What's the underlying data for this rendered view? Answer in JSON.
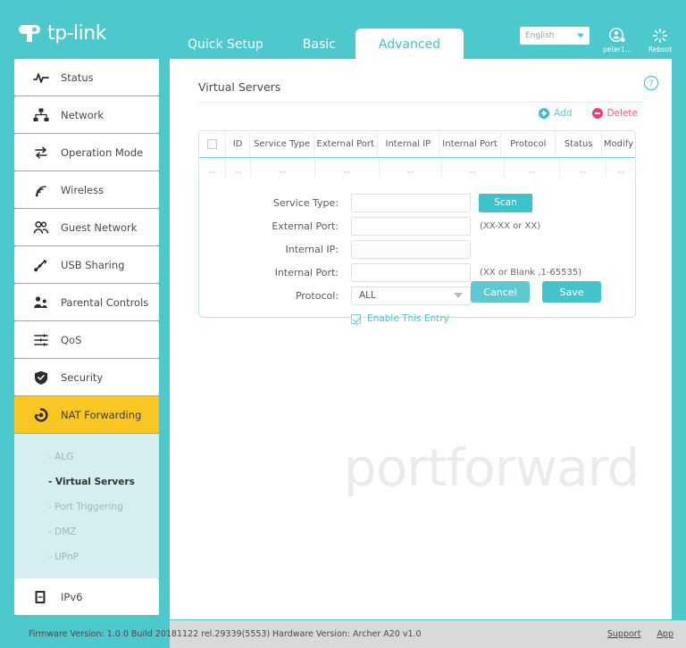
{
  "header": {
    "brand": "tp-link",
    "tabs": [
      {
        "label": "Quick Setup",
        "active": false
      },
      {
        "label": "Basic",
        "active": false
      },
      {
        "label": "Advanced",
        "active": true
      }
    ],
    "language": "English",
    "user_label": "peter1...",
    "reboot_label": "Reboot"
  },
  "sidebar": {
    "items": [
      {
        "label": "Status",
        "icon": "pulse-icon"
      },
      {
        "label": "Network",
        "icon": "network-icon"
      },
      {
        "label": "Operation Mode",
        "icon": "swap-icon"
      },
      {
        "label": "Wireless",
        "icon": "wifi-icon"
      },
      {
        "label": "Guest Network",
        "icon": "guest-icon"
      },
      {
        "label": "USB Sharing",
        "icon": "usb-icon"
      },
      {
        "label": "Parental Controls",
        "icon": "parental-icon"
      },
      {
        "label": "QoS",
        "icon": "qos-icon"
      },
      {
        "label": "Security",
        "icon": "shield-icon"
      },
      {
        "label": "NAT Forwarding",
        "icon": "nat-icon",
        "active": true
      },
      {
        "label": "IPv6",
        "icon": "document-icon"
      }
    ],
    "subitems": [
      {
        "label": "- ALG",
        "active": false
      },
      {
        "label": "- Virtual Servers",
        "active": true
      },
      {
        "label": "- Port Triggering",
        "active": false
      },
      {
        "label": "- DMZ",
        "active": false
      },
      {
        "label": "- UPnP",
        "active": false
      }
    ]
  },
  "content": {
    "title": "Virtual Servers",
    "toolbar": {
      "add_label": "Add",
      "delete_label": "Delete"
    },
    "table": {
      "columns": [
        "",
        "ID",
        "Service Type",
        "External Port",
        "Internal IP",
        "Internal Port",
        "Protocol",
        "Status",
        "Modify"
      ],
      "rows": [
        [
          "--",
          "--",
          "--",
          "--",
          "--",
          "--",
          "--",
          "--",
          "--"
        ]
      ]
    },
    "form": {
      "service_type_label": "Service Type:",
      "service_type_value": "",
      "scan_label": "Scan",
      "external_port_label": "External Port:",
      "external_port_value": "",
      "external_port_hint": "(XX-XX or XX)",
      "internal_ip_label": "Internal IP:",
      "internal_ip_value": "",
      "internal_port_label": "Internal Port:",
      "internal_port_value": "",
      "internal_port_hint": "(XX or Blank ,1-65535)",
      "protocol_label": "Protocol:",
      "protocol_value": "ALL",
      "enable_label": "Enable This Entry",
      "cancel_label": "Cancel",
      "save_label": "Save"
    },
    "watermark": "portforward"
  },
  "footer": {
    "firmware": "Firmware Version: 1.0.0 Build 20181122 rel.29339(5553)",
    "hardware": "Hardware Version: Archer A20 v1.0",
    "support_label": "Support",
    "app_label": "App"
  },
  "colors": {
    "teal": "#4dc8cd",
    "accent_yellow": "#f9c623",
    "delete_pink": "#e8417a",
    "submenu_bg": "#d4efee"
  }
}
